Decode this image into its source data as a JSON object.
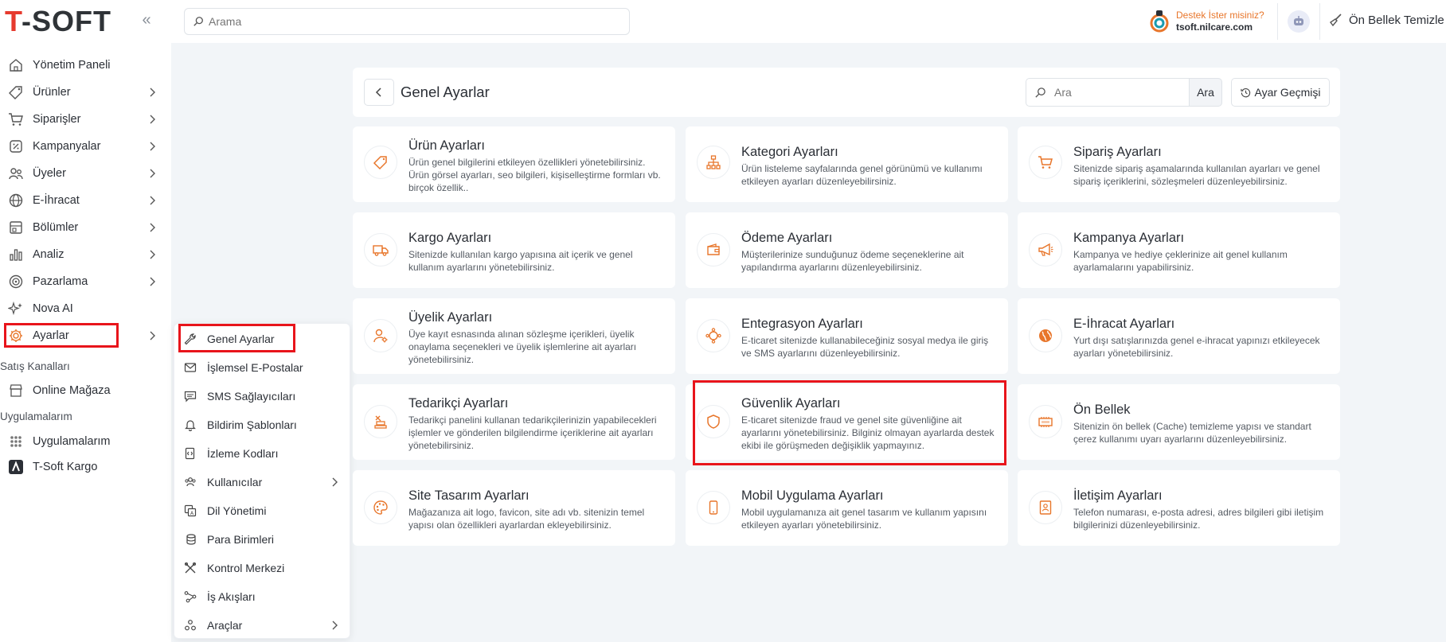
{
  "brand": {
    "logo_first": "T",
    "logo_rest": "-SOFT"
  },
  "topbar": {
    "search_placeholder": "Arama",
    "support_title": "Destek İster misiniz?",
    "support_domain": "tsoft.nilcare.com",
    "cache_label": "Ön Bellek Temizle"
  },
  "sidebar": {
    "items": [
      {
        "label": "Yönetim Paneli",
        "icon": "home-icon"
      },
      {
        "label": "Ürünler",
        "icon": "tag-icon"
      },
      {
        "label": "Siparişler",
        "icon": "cart-icon"
      },
      {
        "label": "Kampanyalar",
        "icon": "discount-icon"
      },
      {
        "label": "Üyeler",
        "icon": "users-icon"
      },
      {
        "label": "E-İhracat",
        "icon": "globe-icon"
      },
      {
        "label": "Bölümler",
        "icon": "sections-icon"
      },
      {
        "label": "Analiz",
        "icon": "chart-icon"
      },
      {
        "label": "Pazarlama",
        "icon": "target-icon"
      },
      {
        "label": "Nova AI",
        "icon": "sparkle-icon"
      },
      {
        "label": "Ayarlar",
        "icon": "gear-icon"
      }
    ],
    "sales_channels_label": "Satış Kanalları",
    "online_store": "Online Mağaza",
    "apps_section_label": "Uygulamalarım",
    "apps_item": "Uygulamalarım",
    "tsoft_kargo": "T-Soft Kargo"
  },
  "submenu": {
    "items": [
      {
        "label": "Genel Ayarlar",
        "icon": "wrench-icon"
      },
      {
        "label": "İşlemsel E-Postalar",
        "icon": "mail-icon"
      },
      {
        "label": "SMS Sağlayıcıları",
        "icon": "message-icon"
      },
      {
        "label": "Bildirim Şablonları",
        "icon": "bell-icon"
      },
      {
        "label": "İzleme Kodları",
        "icon": "code-icon"
      },
      {
        "label": "Kullanıcılar",
        "icon": "user-group-icon"
      },
      {
        "label": "Dil Yönetimi",
        "icon": "language-icon"
      },
      {
        "label": "Para Birimleri",
        "icon": "coins-icon"
      },
      {
        "label": "Kontrol Merkezi",
        "icon": "tools-icon"
      },
      {
        "label": "İş Akışları",
        "icon": "workflow-icon"
      },
      {
        "label": "Araçlar",
        "icon": "apps-icon"
      }
    ]
  },
  "main": {
    "title": "Genel Ayarlar",
    "search_placeholder": "Ara",
    "search_button": "Ara",
    "history_button": "Ayar Geçmişi",
    "cards": [
      {
        "title": "Ürün Ayarları",
        "desc": "Ürün genel bilgilerini etkileyen özellikleri yönetebilirsiniz. Ürün görsel ayarları, seo bilgileri, kişiselleştirme formları vb. birçok özellik..",
        "icon": "tag-icon"
      },
      {
        "title": "Kategori Ayarları",
        "desc": "Ürün listeleme sayfalarında genel görünümü ve kullanımı etkileyen ayarları düzenleyebilirsiniz.",
        "icon": "sitemap-icon"
      },
      {
        "title": "Sipariş Ayarları",
        "desc": "Sitenizde sipariş aşamalarında kullanılan ayarları ve genel sipariş içeriklerini, sözleşmeleri düzenleyebilirsiniz.",
        "icon": "cart-icon"
      },
      {
        "title": "Kargo Ayarları",
        "desc": "Sitenizde kullanılan kargo yapısına ait içerik ve genel kullanım ayarlarını yönetebilirsiniz.",
        "icon": "truck-icon"
      },
      {
        "title": "Ödeme Ayarları",
        "desc": "Müşterilerinize sunduğunuz ödeme seçeneklerine ait yapılandırma ayarlarını düzenleyebilirsiniz.",
        "icon": "wallet-icon"
      },
      {
        "title": "Kampanya Ayarları",
        "desc": "Kampanya ve hediye çeklerinize ait genel kullanım ayarlamalarını yapabilirsiniz.",
        "icon": "megaphone-icon"
      },
      {
        "title": "Üyelik Ayarları",
        "desc": "Üye kayıt esnasında alınan sözleşme içerikleri, üyelik onaylama seçenekleri ve üyelik işlemlerine ait ayarları yönetebilirsiniz.",
        "icon": "user-gear-icon"
      },
      {
        "title": "Entegrasyon Ayarları",
        "desc": "E-ticaret sitenizde kullanabileceğiniz sosyal medya ile giriş ve SMS ayarlarını düzenleyebilirsiniz.",
        "icon": "integration-icon"
      },
      {
        "title": "E-İhracat Ayarları",
        "desc": "Yurt dışı satışlarınızda genel e-ihracat yapınızı etkileyecek ayarları yönetebilirsiniz.",
        "icon": "globe-icon"
      },
      {
        "title": "Tedarikçi Ayarları",
        "desc": "Tedarikçi panelini kullanan tedarikçilerinizin yapabilecekleri işlemler ve gönderilen bilgilendirme içeriklerine ait ayarları yönetebilirsiniz.",
        "icon": "supplier-icon"
      },
      {
        "title": "Güvenlik Ayarları",
        "desc": "E-ticaret sitenizde fraud ve genel site güvenliğine ait ayarlarını yönetebilirsiniz. Bilginiz olmayan ayarlarda destek ekibi ile görüşmeden değişiklik yapmayınız.",
        "icon": "shield-icon"
      },
      {
        "title": "Ön Bellek",
        "desc": "Sitenizin ön bellek (Cache) temizleme yapısı ve standart çerez kullanımı uyarı ayarlarını düzenleyebilirsiniz.",
        "icon": "memory-icon"
      },
      {
        "title": "Site Tasarım Ayarları",
        "desc": "Mağazanıza ait logo, favicon, site adı vb. sitenizin temel yapısı olan özellikleri ayarlardan ekleyebilirsiniz.",
        "icon": "palette-icon"
      },
      {
        "title": "Mobil Uygulama Ayarları",
        "desc": "Mobil uygulamanıza ait genel tasarım ve kullanım yapısını etkileyen ayarları yönetebilirsiniz.",
        "icon": "mobile-icon"
      },
      {
        "title": "İletişim Ayarları",
        "desc": "Telefon numarası, e-posta adresi, adres bilgileri gibi iletişim bilgilerinizi düzenleyebilirsiniz.",
        "icon": "contact-icon"
      }
    ]
  },
  "colors": {
    "brand_red": "#e63a2e",
    "highlight": "#e8141b",
    "support_orange": "#e8762b",
    "icon_orange": "#e8762b"
  }
}
